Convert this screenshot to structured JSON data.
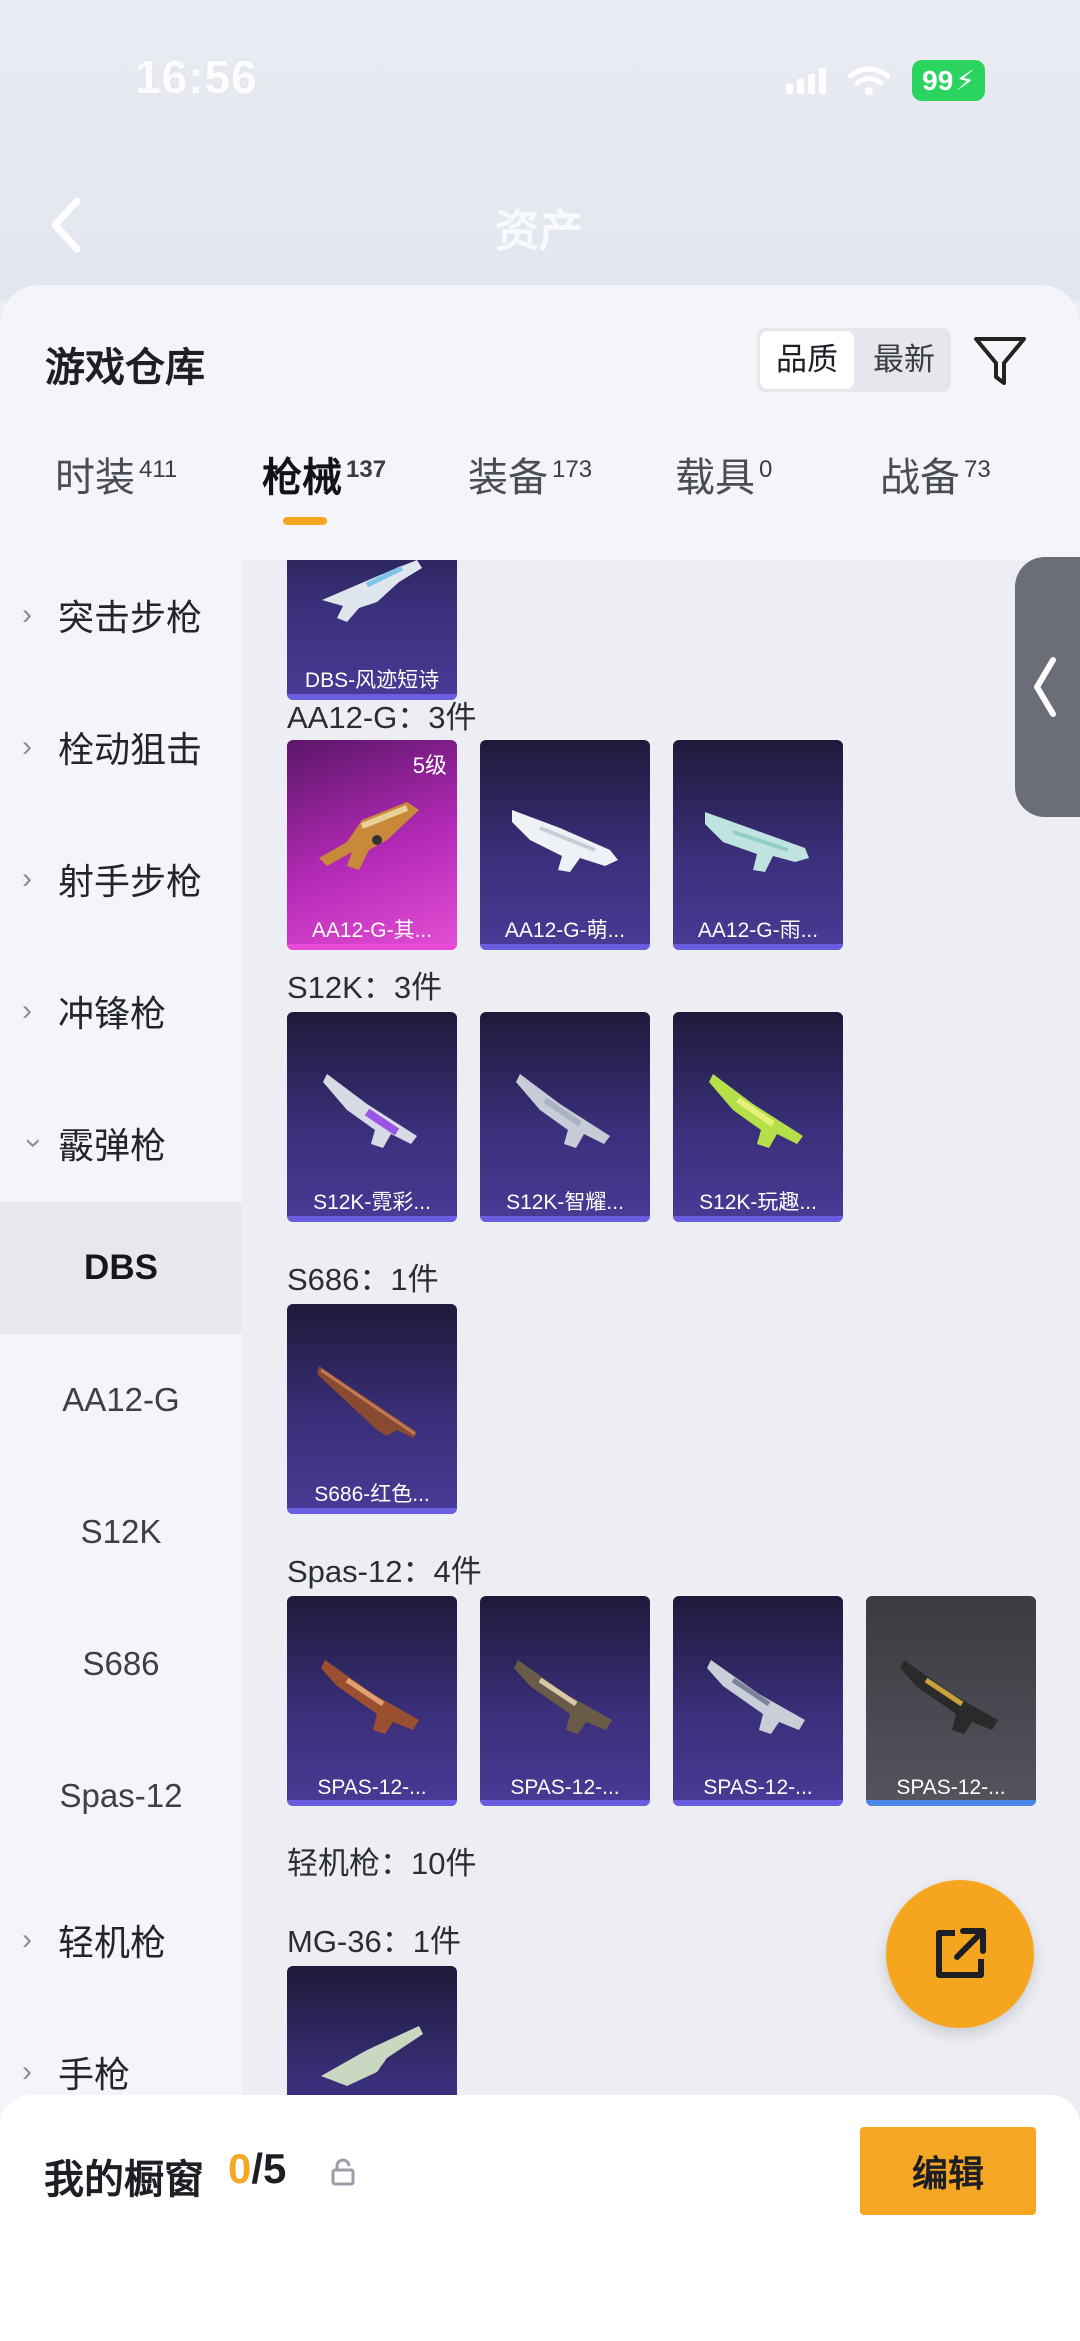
{
  "status_bar": {
    "time": "16:56",
    "battery": "99"
  },
  "bg_header": {
    "title": "资产"
  },
  "panel": {
    "title": "游戏仓库",
    "sort": {
      "options": [
        "品质",
        "最新"
      ],
      "selected": "品质"
    }
  },
  "tabs": [
    {
      "label": "时装",
      "count": "411"
    },
    {
      "label": "枪械",
      "count": "137"
    },
    {
      "label": "装备",
      "count": "173"
    },
    {
      "label": "载具",
      "count": "0"
    },
    {
      "label": "战备",
      "count": "73"
    }
  ],
  "active_tab": "枪械",
  "sidebar": {
    "categories": [
      "突击步枪",
      "栓动狙击",
      "射手步枪",
      "冲锋枪",
      "霰弹枪",
      "轻机枪",
      "手枪"
    ],
    "subcategories": [
      "DBS",
      "AA12-G",
      "S12K",
      "S686",
      "Spas-12"
    ],
    "active_sub": "DBS"
  },
  "groups": [
    {
      "label": "AA12-G：3件",
      "items": [
        {
          "name": "AA12-G-其...",
          "level": "5级",
          "rarity": "gold"
        },
        {
          "name": "AA12-G-萌...",
          "rarity": "purple"
        },
        {
          "name": "AA12-G-雨...",
          "rarity": "purple"
        }
      ]
    },
    {
      "label": "S12K：3件",
      "items": [
        {
          "name": "S12K-霓彩...",
          "rarity": "purple"
        },
        {
          "name": "S12K-智耀...",
          "rarity": "purple"
        },
        {
          "name": "S12K-玩趣...",
          "rarity": "purple"
        }
      ]
    },
    {
      "label": "S686：1件",
      "items": [
        {
          "name": "S686-红色...",
          "rarity": "purple"
        }
      ]
    },
    {
      "label": "Spas-12：4件",
      "items": [
        {
          "name": "SPAS-12-...",
          "rarity": "purple"
        },
        {
          "name": "SPAS-12-...",
          "rarity": "purple"
        },
        {
          "name": "SPAS-12-...",
          "rarity": "purple"
        },
        {
          "name": "SPAS-12-...",
          "rarity": "grey"
        }
      ]
    }
  ],
  "top_partial_item": {
    "name": "DBS-风迹短诗"
  },
  "lmg_label": "轻机枪：10件",
  "mg36_label": "MG-36：1件",
  "bottom_bar": {
    "title": "我的橱窗",
    "count_current": "0",
    "count_total": "/5",
    "edit_label": "编辑"
  },
  "colors": {
    "accent": "#f5a623",
    "purple_card": "#3a2f7a",
    "gold_card": "#b62ab8"
  }
}
